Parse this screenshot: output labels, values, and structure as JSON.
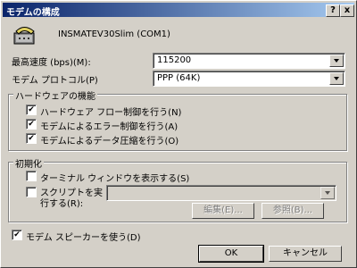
{
  "window": {
    "title": "モデムの構成",
    "help_btn": "?",
    "close_btn": "x"
  },
  "modem": {
    "name": "INSMATEV30Slim (COM1)",
    "icon": "modem-telephone-icon"
  },
  "speed": {
    "label": "最高速度 (bps)(M):",
    "value": "115200"
  },
  "protocol": {
    "label": "モデム プロトコル(P)",
    "value": "PPP  (64K)"
  },
  "hardware": {
    "title": "ハードウェアの機能",
    "options": [
      {
        "label": "ハードウェア フロー制御を行う(N)",
        "checked": true
      },
      {
        "label": "モデムによるエラー制御を行う(A)",
        "checked": true
      },
      {
        "label": "モデムによるデータ圧縮を行う(O)",
        "checked": true
      }
    ]
  },
  "init": {
    "title": "初期化",
    "terminal_label": "ターミナル ウィンドウを表示する(S)",
    "script_label_1": "スクリプトを実",
    "script_label_2": "行する(R):",
    "script_value": "",
    "edit_btn": "編集(E)...",
    "browse_btn": "参照(B)..."
  },
  "speaker": {
    "label": "モデム スピーカーを使う(D)",
    "checked": true
  },
  "buttons": {
    "ok": "OK",
    "cancel": "キャンセル"
  },
  "check_mark": "✔"
}
